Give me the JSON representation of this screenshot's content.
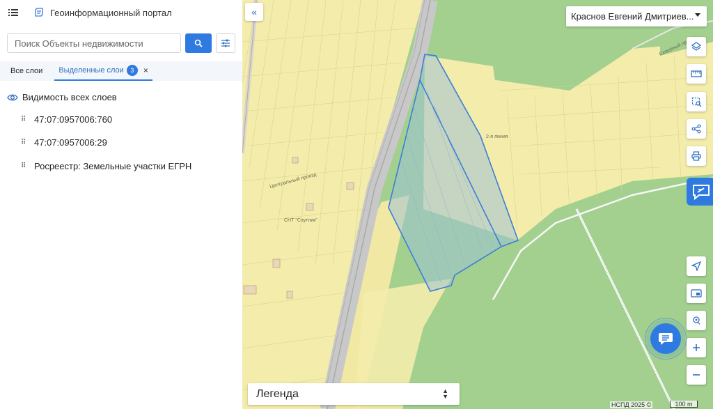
{
  "header": {
    "title": "Геоинформационный портал",
    "menu_icon": "menu-icon",
    "logo_icon": "portal-logo-icon"
  },
  "search": {
    "placeholder": "Поиск Объекты недвижимости",
    "value": ""
  },
  "tabs": {
    "all_layers": "Все слои",
    "selected_layers": "Выделенные слои",
    "selected_count": "3",
    "close": "×"
  },
  "layers": {
    "visibility_label": "Видимость всех слоев",
    "items": [
      {
        "label": "47:07:0957006:760"
      },
      {
        "label": "47:07:0957006:29"
      },
      {
        "label": "Росреестр: Земельные участки ЕГРН"
      }
    ]
  },
  "user": {
    "name": "Краснов Евгений Дмитриев..."
  },
  "map": {
    "labels": {
      "snt": "СНТ \"Спутник\"",
      "proezd": "Центральный проезд",
      "severny": "Северный проезд",
      "line": "2-я линия"
    },
    "legend": "Легенда",
    "attribution": "НСПД 2025 ©",
    "scale": "100 m"
  },
  "colors": {
    "accent": "#2f7ae0",
    "map_green": "#a3d08f",
    "map_yellow": "#f3ecab",
    "parcel_outline": "#3b7dd8",
    "parcel_fill": "#9fc3d6"
  }
}
